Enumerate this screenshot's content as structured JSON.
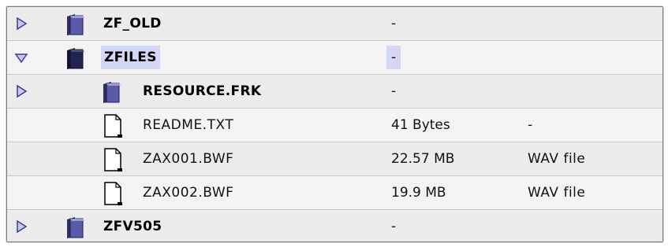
{
  "rows": [
    {
      "name": "ZF_OLD",
      "size": "-",
      "kind": ""
    },
    {
      "name": "ZFILES",
      "size": "-",
      "kind": ""
    },
    {
      "name": "RESOURCE.FRK",
      "size": "-",
      "kind": ""
    },
    {
      "name": "README.TXT",
      "size": "41 Bytes",
      "kind": "-"
    },
    {
      "name": "ZAX001.BWF",
      "size": "22.57 MB",
      "kind": "WAV file"
    },
    {
      "name": "ZAX002.BWF",
      "size": "19.9 MB",
      "kind": "WAV file"
    },
    {
      "name": "ZFV505",
      "size": "-",
      "kind": ""
    }
  ],
  "colors": {
    "selection": "#d6d6f5",
    "disclosure": "#6b6bd6",
    "folder": "#5a5aa8"
  }
}
